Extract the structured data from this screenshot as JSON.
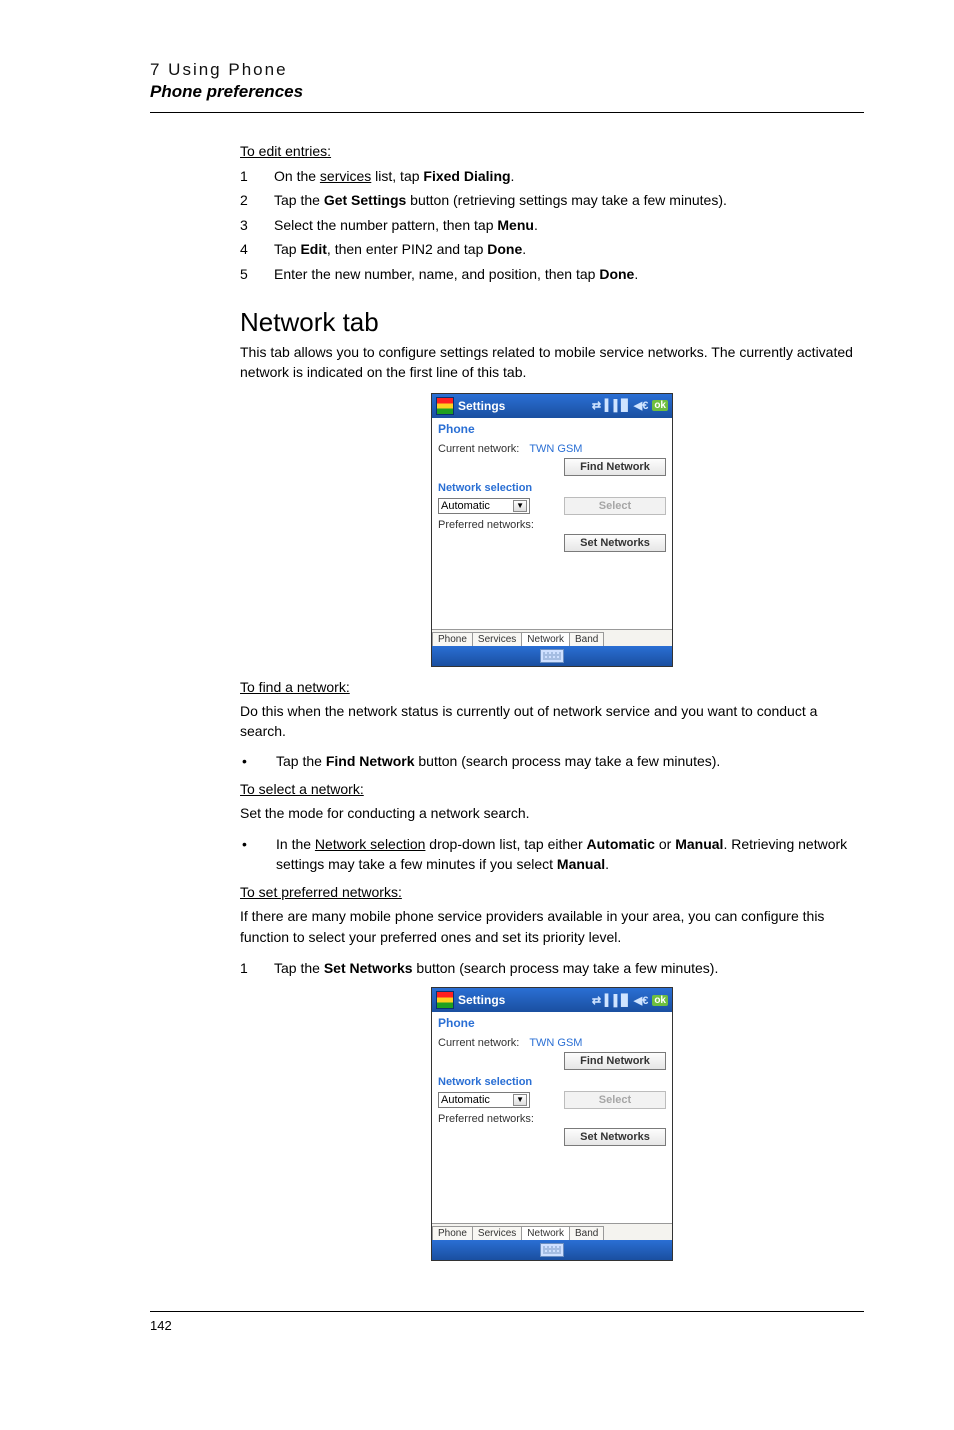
{
  "header": {
    "chapter": "7 Using Phone",
    "section": "Phone preferences"
  },
  "edit_entries": {
    "title": "To edit entries:",
    "steps": [
      {
        "n": "1",
        "pre": "On the ",
        "link": "services",
        "mid": " list, tap ",
        "bold": "Fixed Dialing",
        "post": "."
      },
      {
        "n": "2",
        "pre": "Tap the ",
        "bold": "Get Settings",
        "post": " button (retrieving settings may take a few minutes)."
      },
      {
        "n": "3",
        "pre": "Select the number pattern, then tap ",
        "bold": "Menu",
        "post": "."
      },
      {
        "n": "4",
        "pre": "Tap ",
        "bold": "Edit",
        "mid": ", then enter PIN2 and tap ",
        "bold2": "Done",
        "post": "."
      },
      {
        "n": "5",
        "pre": "Enter the new number, name, and position, then tap ",
        "bold": "Done",
        "post": "."
      }
    ]
  },
  "network_tab": {
    "heading": "Network tab",
    "intro": "This tab allows you to configure settings related to mobile service networks. The currently activated network is indicated on the first line of this tab."
  },
  "screenshot": {
    "titlebar": "Settings",
    "ok": "ok",
    "sheet_title": "Phone",
    "current_network_label": "Current network:",
    "current_network_value": "TWN GSM",
    "find_btn": "Find Network",
    "section_label": "Network selection",
    "dd_value": "Automatic",
    "select_btn": "Select",
    "pref_label": "Preferred networks:",
    "set_btn": "Set Networks",
    "tabs": [
      "Phone",
      "Services",
      "Network",
      "Band"
    ]
  },
  "find_net": {
    "title": "To find a network:",
    "para": "Do this when the network status is currently out of network service and you want to conduct a search.",
    "bullet_pre": "Tap the ",
    "bullet_bold": "Find Network",
    "bullet_post": " button (search process may take a few minutes)."
  },
  "select_net": {
    "title": "To select a network:",
    "para": "Set the mode for conducting a network search.",
    "bullet_pre": "In the ",
    "bullet_link": "Network selection",
    "bullet_mid": " drop-down list, tap either ",
    "bullet_b1": "Automatic",
    "bullet_or": " or ",
    "bullet_b2": "Manual",
    "bullet_post1": ". Retrieving network settings may take a few minutes if you select ",
    "bullet_b3": "Manual",
    "bullet_post2": "."
  },
  "pref_net": {
    "title": "To set preferred networks:",
    "para": "If there are many mobile phone service providers available in your area, you can configure this function to select your preferred ones and set its priority level.",
    "step_n": "1",
    "step_pre": "Tap the ",
    "step_bold": "Set Networks",
    "step_post": " button (search process may take a few minutes)."
  },
  "page_number": "142"
}
